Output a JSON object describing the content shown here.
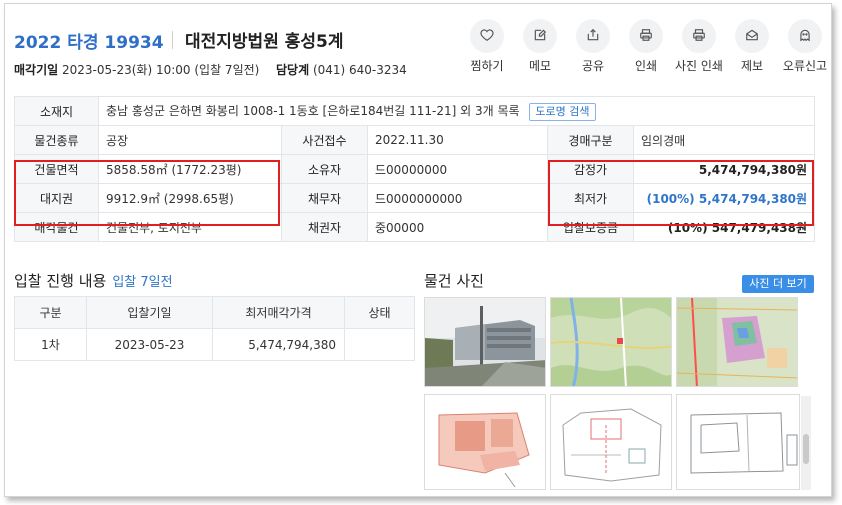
{
  "header": {
    "case_number": "2022 타경 19934",
    "court": "대전지방법원 홍성5계",
    "sale_date_label": "매각기일",
    "sale_date_value": "2023-05-23(화) 10:00 (입찰 7일전)",
    "dept_label": "담당계",
    "dept_value": "(041) 640-3234"
  },
  "toolbar": [
    {
      "label": "찜하기",
      "icon": "heart-icon"
    },
    {
      "label": "메모",
      "icon": "memo-icon"
    },
    {
      "label": "공유",
      "icon": "share-icon"
    },
    {
      "label": "인쇄",
      "icon": "print-icon"
    },
    {
      "label": "사진 인쇄",
      "icon": "photo-print-icon"
    },
    {
      "label": "제보",
      "icon": "report-icon"
    },
    {
      "label": "오류신고",
      "icon": "error-report-icon"
    }
  ],
  "info": {
    "location_label": "소재지",
    "location_value": "충남 홍성군 은하면 화봉리 1008-1 1동호 [은하로184번길 111-21] 외 3개 목록",
    "road_btn": "도로명 검색",
    "type_label": "물건종류",
    "type_value": "공장",
    "filed_label": "사건접수",
    "filed_value": "2022.11.30",
    "auction_type_label": "경매구분",
    "auction_type_value": "임의경매",
    "building_area_label": "건물면적",
    "building_area_value": "5858.58㎡ (1772.23평)",
    "owner_label": "소유자",
    "owner_value": "드00000000",
    "appraisal_label": "감정가",
    "appraisal_value": "5,474,794,380원",
    "land_right_label": "대지권",
    "land_right_value": "9912.9㎡ (2998.65평)",
    "debtor_label": "채무자",
    "debtor_value": "드0000000000",
    "minimum_label": "최저가",
    "minimum_value": "(100%) 5,474,794,380원",
    "sale_item_label": "매각물건",
    "sale_item_value": "건물전부, 토지전부",
    "creditor_label": "채권자",
    "creditor_value": "중00000",
    "deposit_label": "입찰보증금",
    "deposit_value": "(10%) 547,479,438원"
  },
  "bid_section": {
    "title": "입찰 진행 내용",
    "subtitle": "입찰 7일전",
    "columns": [
      "구분",
      "입찰기일",
      "최저매각가격",
      "상태"
    ],
    "rows": [
      [
        "1차",
        "2023-05-23",
        "5,474,794,380",
        ""
      ]
    ]
  },
  "photo_section": {
    "title": "물건 사진",
    "more_btn": "사진 더 보기"
  },
  "colors": {
    "accent_blue": "#2f6fc7",
    "highlight_red": "#e02020",
    "button_blue": "#3a8ee6"
  }
}
